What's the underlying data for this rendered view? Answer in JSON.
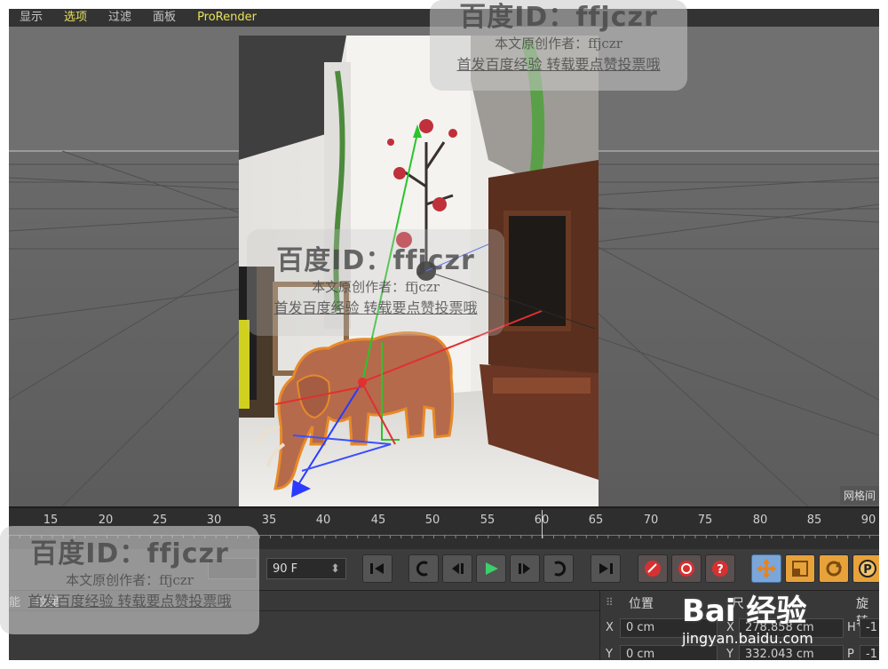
{
  "menu": {
    "items": [
      "显示",
      "选项",
      "过滤",
      "面板",
      "ProRender"
    ],
    "active_index": 1
  },
  "viewport": {
    "grid_label": "网格间"
  },
  "timeline": {
    "ticks": [
      "15",
      "20",
      "25",
      "30",
      "35",
      "40",
      "45",
      "50",
      "55",
      "60",
      "65",
      "70",
      "75",
      "80",
      "85",
      "90"
    ],
    "current_frame": 60
  },
  "transport": {
    "end_frame": "90 F",
    "buttons": [
      "go-to-start",
      "previous-key",
      "previous-frame",
      "play-forward",
      "next-frame",
      "next-key",
      "go-to-end",
      "record",
      "autokey",
      "keyframe-selection",
      "move-tool",
      "scale-tool",
      "rotate-tool",
      "param-tool"
    ]
  },
  "bottom_panel": {
    "tabs": [
      "能",
      "纹理"
    ],
    "coordinates": {
      "position_label": "位置",
      "rotation_label": "旋转",
      "size_label": "尺",
      "x_label": "X",
      "y_label": "Y",
      "pos_x": "0 cm",
      "pos_y": "0 cm",
      "size_x": "278.858 cm",
      "size_y": "332.043 cm",
      "h_label": "H",
      "p_label": "P",
      "rot_h": "-1",
      "rot_p": "-1"
    }
  },
  "watermarks": {
    "id_text": "百度ID：ffjczr",
    "author_text": "本文原创作者：ffjczr",
    "notice_text": "首发百度经验 转载要点赞投票哦",
    "brand_main": "Bai 经验",
    "brand_url": "jingyan.baidu.com"
  },
  "colors": {
    "accent_yellow": "#e8e25a",
    "tool_blue": "#7aa6d9",
    "model_brown": "#b56a4c"
  }
}
